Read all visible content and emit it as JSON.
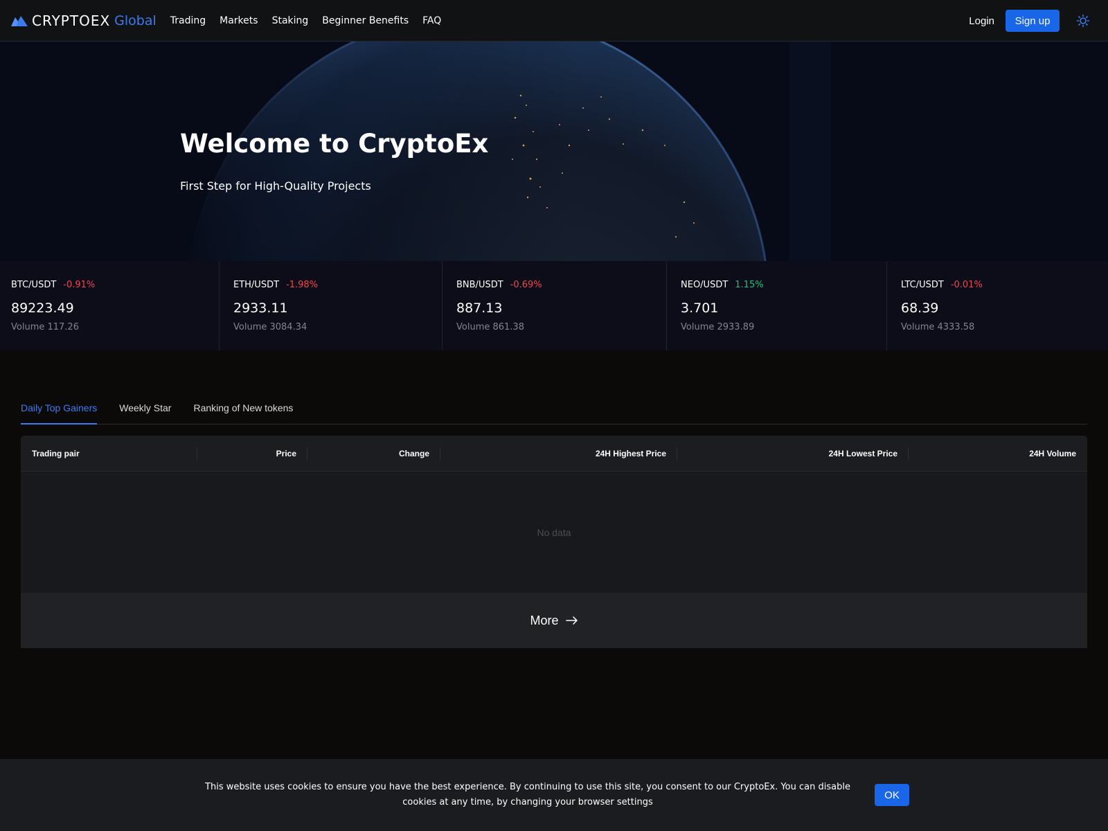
{
  "brand": {
    "name": "CRYPTOEX",
    "suffix": "Global",
    "logo_icon": "mountain-logo-icon",
    "accent_color": "#3a7cf0",
    "button_color": "#1a66e8"
  },
  "nav": {
    "items": [
      {
        "label": "Trading"
      },
      {
        "label": "Markets"
      },
      {
        "label": "Staking"
      },
      {
        "label": "Beginner Benefits"
      },
      {
        "label": "FAQ"
      }
    ],
    "login_label": "Login",
    "signup_label": "Sign up",
    "theme_icon": "sun-icon"
  },
  "hero": {
    "title": "Welcome to CryptoEx",
    "subtitle": "First Step for High-Quality Projects"
  },
  "tickers": [
    {
      "pair": "BTC/USDT",
      "change": "-0.91%",
      "direction": "down",
      "price": "89223.49",
      "volume": "Volume 117.26"
    },
    {
      "pair": "ETH/USDT",
      "change": "-1.98%",
      "direction": "down",
      "price": "2933.11",
      "volume": "Volume 3084.34"
    },
    {
      "pair": "BNB/USDT",
      "change": "-0.69%",
      "direction": "down",
      "price": "887.13",
      "volume": "Volume 861.38"
    },
    {
      "pair": "NEO/USDT",
      "change": "1.15%",
      "direction": "up",
      "price": "3.701",
      "volume": "Volume 2933.89"
    },
    {
      "pair": "LTC/USDT",
      "change": "-0.01%",
      "direction": "down",
      "price": "68.39",
      "volume": "Volume 4333.58"
    }
  ],
  "rankings": {
    "tabs": [
      {
        "label": "Daily Top Gainers",
        "active": true
      },
      {
        "label": "Weekly Star",
        "active": false
      },
      {
        "label": "Ranking of New tokens",
        "active": false
      }
    ],
    "columns": [
      "Trading pair",
      "Price",
      "Change",
      "24H Highest Price",
      "24H Lowest Price",
      "24H Volume"
    ],
    "empty_text": "No data",
    "more_label": "More"
  },
  "cookie": {
    "text": "This website uses cookies to ensure you have the best experience. By continuing to use this site, you consent to our CryptoEx. You can disable cookies at any time, by changing your browser settings",
    "ok_label": "OK"
  }
}
